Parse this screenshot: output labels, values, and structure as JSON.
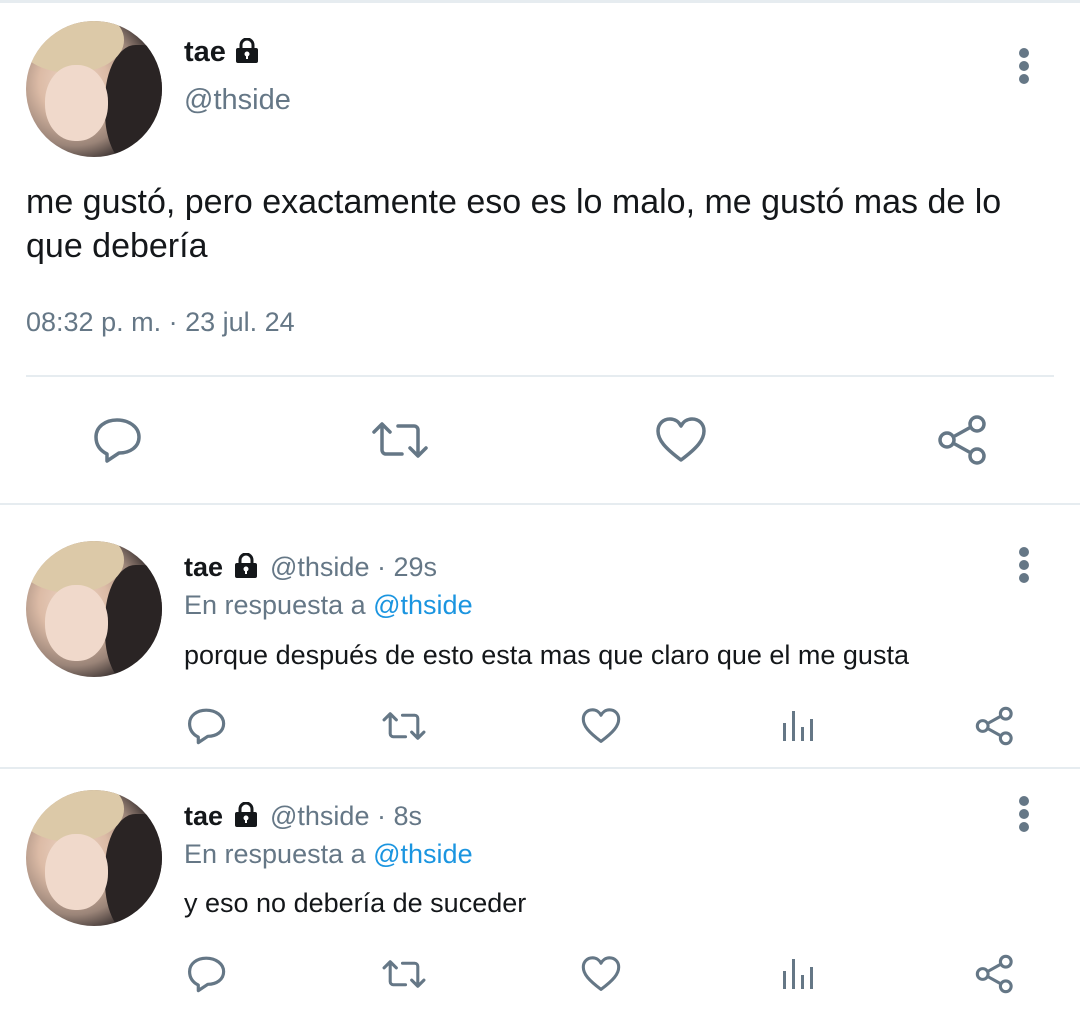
{
  "main_tweet": {
    "author_name": "tae",
    "author_handle": "@thside",
    "text": "me gustó, pero exactamente eso es lo malo, me gustó mas de lo que debería",
    "timestamp": "08:32 p. m. · 23 jul. 24"
  },
  "replies": [
    {
      "author_name": "tae",
      "handle_time": "@thside · 29s",
      "reply_prefix": "En respuesta a ",
      "reply_mention": "@thside",
      "text": "porque después de esto esta mas que claro que el me gusta"
    },
    {
      "author_name": "tae",
      "handle_time": "@thside · 8s",
      "reply_prefix": "En respuesta a ",
      "reply_mention": "@thside",
      "text": "y eso no debería de suceder"
    }
  ],
  "icons": {
    "actions_main": [
      "reply-icon",
      "retweet-icon",
      "like-icon",
      "share-icon"
    ],
    "actions_reply": [
      "reply-icon",
      "retweet-icon",
      "like-icon",
      "analytics-icon",
      "share-icon"
    ],
    "protected": "lock-icon",
    "menu": "more-vertical-icon"
  },
  "colors": {
    "text": "#14171a",
    "secondary": "#657786",
    "link": "#1b95e0",
    "divider": "#e6ecf0"
  }
}
